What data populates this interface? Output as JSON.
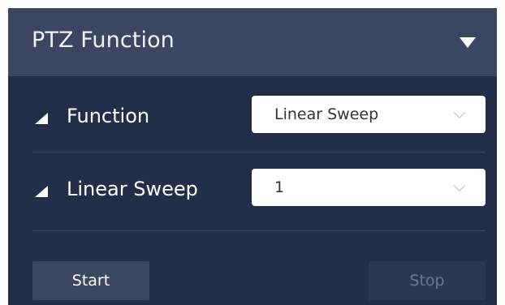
{
  "header": {
    "title": "PTZ Function",
    "toggle_icon": "triangle-down-icon"
  },
  "rows": [
    {
      "label": "Function",
      "icon": "triangle-corner-icon",
      "select": {
        "value": "Linear Sweep",
        "chevron": "chevron-down-icon"
      }
    },
    {
      "label": "Linear Sweep",
      "icon": "triangle-corner-icon",
      "select": {
        "value": "1",
        "chevron": "chevron-down-icon"
      }
    }
  ],
  "buttons": {
    "start": "Start",
    "stop": "Stop"
  },
  "colors": {
    "panel_bg": "#232f4a",
    "header_bg": "#3b4762",
    "button_bg": "#3b4762",
    "disabled_text": "#6e7891"
  }
}
